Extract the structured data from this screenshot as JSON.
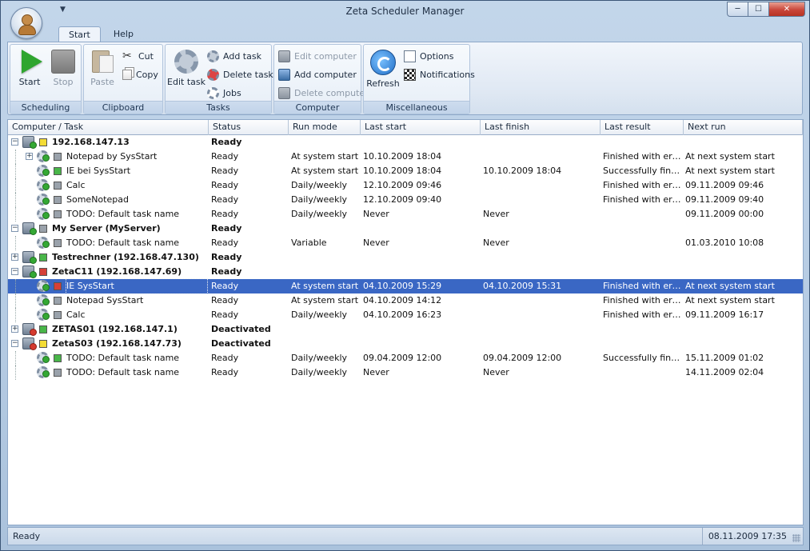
{
  "window": {
    "title": "Zeta Scheduler Manager",
    "minimize": "─",
    "maximize": "☐",
    "close": "✕"
  },
  "tabs": [
    {
      "label": "Start",
      "active": true
    },
    {
      "label": "Help",
      "active": false
    }
  ],
  "ribbon": {
    "scheduling": {
      "label": "Scheduling",
      "start": "Start",
      "stop": "Stop"
    },
    "clipboard": {
      "label": "Clipboard",
      "paste": "Paste",
      "cut": "Cut",
      "copy": "Copy"
    },
    "tasks": {
      "label": "Tasks",
      "edit_task": "Edit task",
      "add_task": "Add task",
      "delete_task": "Delete task",
      "jobs": "Jobs"
    },
    "computer": {
      "label": "Computer",
      "edit_computer": "Edit computer",
      "add_computer": "Add computer",
      "delete_computer": "Delete computer"
    },
    "misc": {
      "label": "Miscellaneous",
      "refresh": "Refresh",
      "options": "Options",
      "notifications": "Notifications"
    }
  },
  "grid": {
    "columns": [
      "Computer / Task",
      "Status",
      "Run mode",
      "Last start",
      "Last finish",
      "Last result",
      "Next run"
    ],
    "rows": [
      {
        "level": 0,
        "expander": "−",
        "state": "yellow",
        "icon": "server",
        "badge": "ok",
        "name": "192.168.147.13",
        "status": "Ready",
        "runmode": "",
        "laststart": "",
        "lastfinish": "",
        "lastresult": "",
        "nextrun": ""
      },
      {
        "level": 1,
        "expander": "+",
        "state": "gray",
        "icon": "task",
        "badge": "ok",
        "name": "Notepad by SysStart",
        "status": "Ready",
        "runmode": "At system start",
        "laststart": "10.10.2009 18:04",
        "lastfinish": "",
        "lastresult": "Finished with erro...",
        "nextrun": "At next system start"
      },
      {
        "level": 1,
        "expander": "",
        "state": "green",
        "icon": "task",
        "badge": "ok",
        "name": "IE bei SysStart",
        "status": "Ready",
        "runmode": "At system start",
        "laststart": "10.10.2009 18:04",
        "lastfinish": "10.10.2009 18:04",
        "lastresult": "Successfully finish...",
        "nextrun": "At next system start"
      },
      {
        "level": 1,
        "expander": "",
        "state": "gray",
        "icon": "task",
        "badge": "ok",
        "name": "Calc",
        "status": "Ready",
        "runmode": "Daily/weekly",
        "laststart": "12.10.2009 09:46",
        "lastfinish": "",
        "lastresult": "Finished with erro...",
        "nextrun": "09.11.2009 09:46"
      },
      {
        "level": 1,
        "expander": "",
        "state": "gray",
        "icon": "task",
        "badge": "ok",
        "name": "SomeNotepad",
        "status": "Ready",
        "runmode": "Daily/weekly",
        "laststart": "12.10.2009 09:40",
        "lastfinish": "",
        "lastresult": "Finished with erro...",
        "nextrun": "09.11.2009 09:40"
      },
      {
        "level": 1,
        "expander": "",
        "state": "gray",
        "icon": "task",
        "badge": "ok",
        "name": "TODO: Default task name",
        "status": "Ready",
        "runmode": "Daily/weekly",
        "laststart": "Never",
        "lastfinish": "Never",
        "lastresult": "",
        "nextrun": "09.11.2009 00:00"
      },
      {
        "level": 0,
        "expander": "−",
        "state": "gray",
        "icon": "server",
        "badge": "ok",
        "name": "My Server (MyServer)",
        "status": "Ready",
        "runmode": "",
        "laststart": "",
        "lastfinish": "",
        "lastresult": "",
        "nextrun": ""
      },
      {
        "level": 1,
        "expander": "",
        "state": "gray",
        "icon": "task",
        "badge": "ok",
        "name": "TODO: Default task name",
        "status": "Ready",
        "runmode": "Variable",
        "laststart": "Never",
        "lastfinish": "Never",
        "lastresult": "",
        "nextrun": "01.03.2010 10:08"
      },
      {
        "level": 0,
        "expander": "+",
        "state": "green",
        "icon": "server",
        "badge": "ok",
        "name": "Testrechner (192.168.47.130)",
        "status": "Ready",
        "runmode": "",
        "laststart": "",
        "lastfinish": "",
        "lastresult": "",
        "nextrun": ""
      },
      {
        "level": 0,
        "expander": "−",
        "state": "red",
        "icon": "server",
        "badge": "ok",
        "name": "ZetaC11 (192.168.147.69)",
        "status": "Ready",
        "runmode": "",
        "laststart": "",
        "lastfinish": "",
        "lastresult": "",
        "nextrun": ""
      },
      {
        "level": 1,
        "expander": "",
        "state": "red",
        "icon": "task",
        "badge": "ok",
        "name": "IE SysStart",
        "status": "Ready",
        "runmode": "At system start",
        "laststart": "04.10.2009 15:29",
        "lastfinish": "04.10.2009 15:31",
        "lastresult": "Finished with erro...",
        "nextrun": "At next system start",
        "selected": true
      },
      {
        "level": 1,
        "expander": "",
        "state": "gray",
        "icon": "task",
        "badge": "ok",
        "name": "Notepad SysStart",
        "status": "Ready",
        "runmode": "At system start",
        "laststart": "04.10.2009 14:12",
        "lastfinish": "",
        "lastresult": "Finished with erro...",
        "nextrun": "At next system start"
      },
      {
        "level": 1,
        "expander": "",
        "state": "gray",
        "icon": "task",
        "badge": "ok",
        "name": "Calc",
        "status": "Ready",
        "runmode": "Daily/weekly",
        "laststart": "04.10.2009 16:23",
        "lastfinish": "",
        "lastresult": "Finished with erro...",
        "nextrun": "09.11.2009 16:17"
      },
      {
        "level": 0,
        "expander": "+",
        "state": "green",
        "icon": "server",
        "badge": "x",
        "name": "ZETAS01 (192.168.147.1)",
        "status": "Deactivated",
        "runmode": "",
        "laststart": "",
        "lastfinish": "",
        "lastresult": "",
        "nextrun": ""
      },
      {
        "level": 0,
        "expander": "−",
        "state": "yellow",
        "icon": "server",
        "badge": "x",
        "name": "ZetaS03 (192.168.147.73)",
        "status": "Deactivated",
        "runmode": "",
        "laststart": "",
        "lastfinish": "",
        "lastresult": "",
        "nextrun": ""
      },
      {
        "level": 1,
        "expander": "",
        "state": "green",
        "icon": "task",
        "badge": "ok",
        "name": "TODO: Default task name",
        "status": "Ready",
        "runmode": "Daily/weekly",
        "laststart": "09.04.2009 12:00",
        "lastfinish": "09.04.2009 12:00",
        "lastresult": "Successfully finish...",
        "nextrun": "15.11.2009 01:02"
      },
      {
        "level": 1,
        "expander": "",
        "state": "gray",
        "icon": "task",
        "badge": "ok",
        "name": "TODO: Default task name",
        "status": "Ready",
        "runmode": "Daily/weekly",
        "laststart": "Never",
        "lastfinish": "Never",
        "lastresult": "",
        "nextrun": "14.11.2009 02:04"
      }
    ]
  },
  "statusbar": {
    "left": "Ready",
    "right": "08.11.2009 17:35"
  },
  "colors": {
    "selection": "#3a67c4",
    "accent": "#2fa52f",
    "state_red": "#d64038",
    "state_yellow": "#f4dc35",
    "state_green": "#49b649"
  }
}
